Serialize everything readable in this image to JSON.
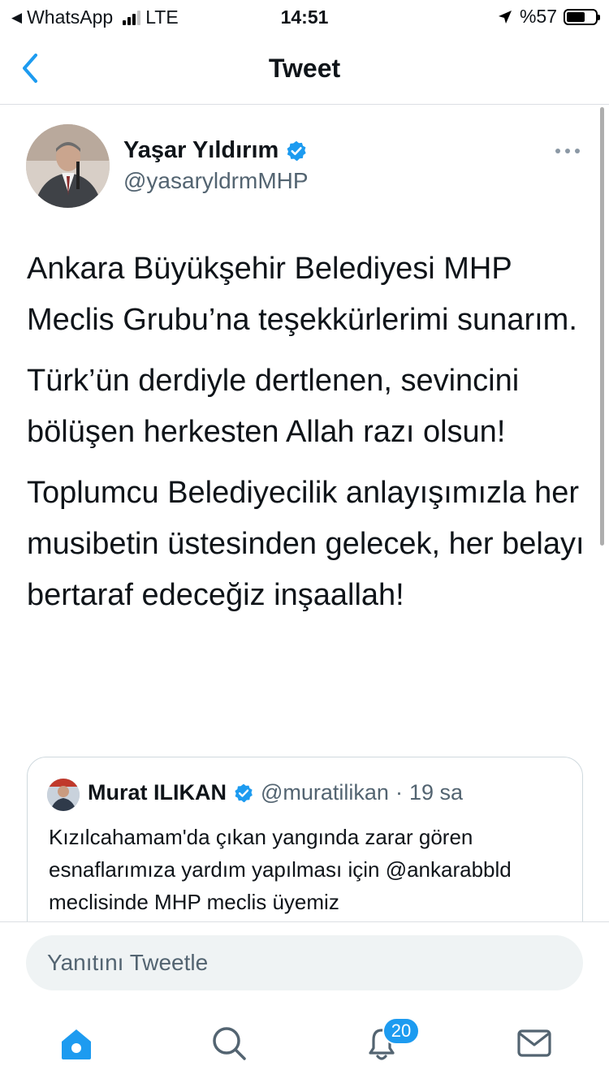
{
  "status_bar": {
    "back_app": "WhatsApp",
    "network": "LTE",
    "time": "14:51",
    "battery": "%57",
    "battery_level": 0.57
  },
  "nav": {
    "title": "Tweet"
  },
  "tweet": {
    "author_name": "Yaşar Yıldırım",
    "author_handle": "@yasaryldrmMHP",
    "paragraphs": [
      "Ankara Büyükşehir Belediyesi MHP Meclis Grubu’na teşekkürlerimi sunarım.",
      "Türk’ün derdiyle dertlenen, sevincini bölüşen herkesten Allah razı olsun!",
      "Toplumcu Belediyecilik anlayışımızla her musibetin üstesinden gelecek, her belayı bertaraf edeceğiz inşaallah!"
    ]
  },
  "quote": {
    "name": "Murat ILIKAN",
    "handle": "@muratilikan",
    "separator": "·",
    "time": "19 sa",
    "text": "Kızılcahamam'da çıkan yangında zarar gören esnaflarımıza yardım yapılması için @ankarabbld meclisinde MHP meclis üyemiz"
  },
  "reply": {
    "placeholder": "Yanıtını Tweetle"
  },
  "tabbar": {
    "notifications_badge": "20"
  },
  "colors": {
    "accent": "#1d9bf0",
    "text": "#0f1419",
    "secondary": "#536471"
  },
  "icons": [
    "back-arrow-icon",
    "signal-icon",
    "location-icon",
    "battery-icon",
    "verified-badge-icon",
    "more-options-icon",
    "home-icon",
    "search-icon",
    "notifications-icon",
    "messages-icon"
  ]
}
